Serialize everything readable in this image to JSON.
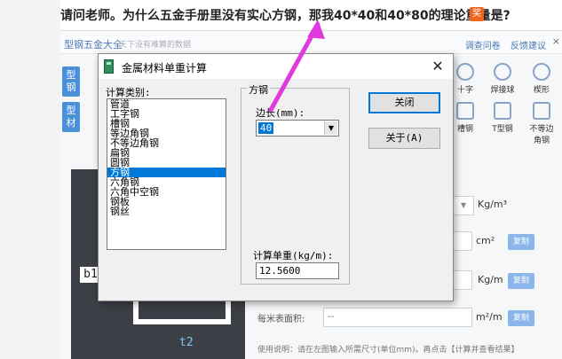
{
  "question": {
    "text": "请问老师。为什么五金手册里没有实心方钢，那我40*40和40*80的理论重量是?",
    "badge": "奖"
  },
  "bg_app": {
    "title": "型钢五金大全",
    "subtitle": "天下没有难算的数据",
    "links": [
      "调查问卷",
      "反馈建议"
    ],
    "close": "×",
    "side_tabs": [
      "型钢",
      "型材"
    ],
    "shape_icons": [
      "十字",
      "焊接球",
      "楔形",
      "槽钢",
      "T型钢",
      "不等边角钢"
    ],
    "preview_labels": {
      "b1": "b1",
      "t2": "t2"
    },
    "units": [
      "Kg/m³",
      "cm²",
      "Kg/m",
      "m²/m"
    ],
    "copy_label": "复制",
    "surface_label": "每米表面积:",
    "surface_value": "--",
    "usage_note": "使用说明：请在左图输入所需尺寸(单位mm)。再点击【计算并查看结果】"
  },
  "dialog": {
    "title": "金属材料单重计算",
    "close_glyph": "✕",
    "category_label": "计算类别:",
    "categories": [
      "管道",
      "工字钢",
      "槽钢",
      "等边角钢",
      "不等边角钢",
      "扁钢",
      "圆钢",
      "方钢",
      "六角钢",
      "六角中空钢",
      "钢板",
      "钢丝"
    ],
    "selected_index": 7,
    "group_title": "方钢",
    "side_length_label": "边长(mm):",
    "side_length_value": "40",
    "unit_weight_label": "计算单重(kg/m):",
    "unit_weight_value": "12.5600",
    "buttons": {
      "close": "关闭",
      "about": "关于(A)"
    }
  },
  "colors": {
    "selection": "#0078d7",
    "annotation_arrow": "#e03adf",
    "side_tab": "#4a8fd9",
    "badge": "#f0641e"
  }
}
